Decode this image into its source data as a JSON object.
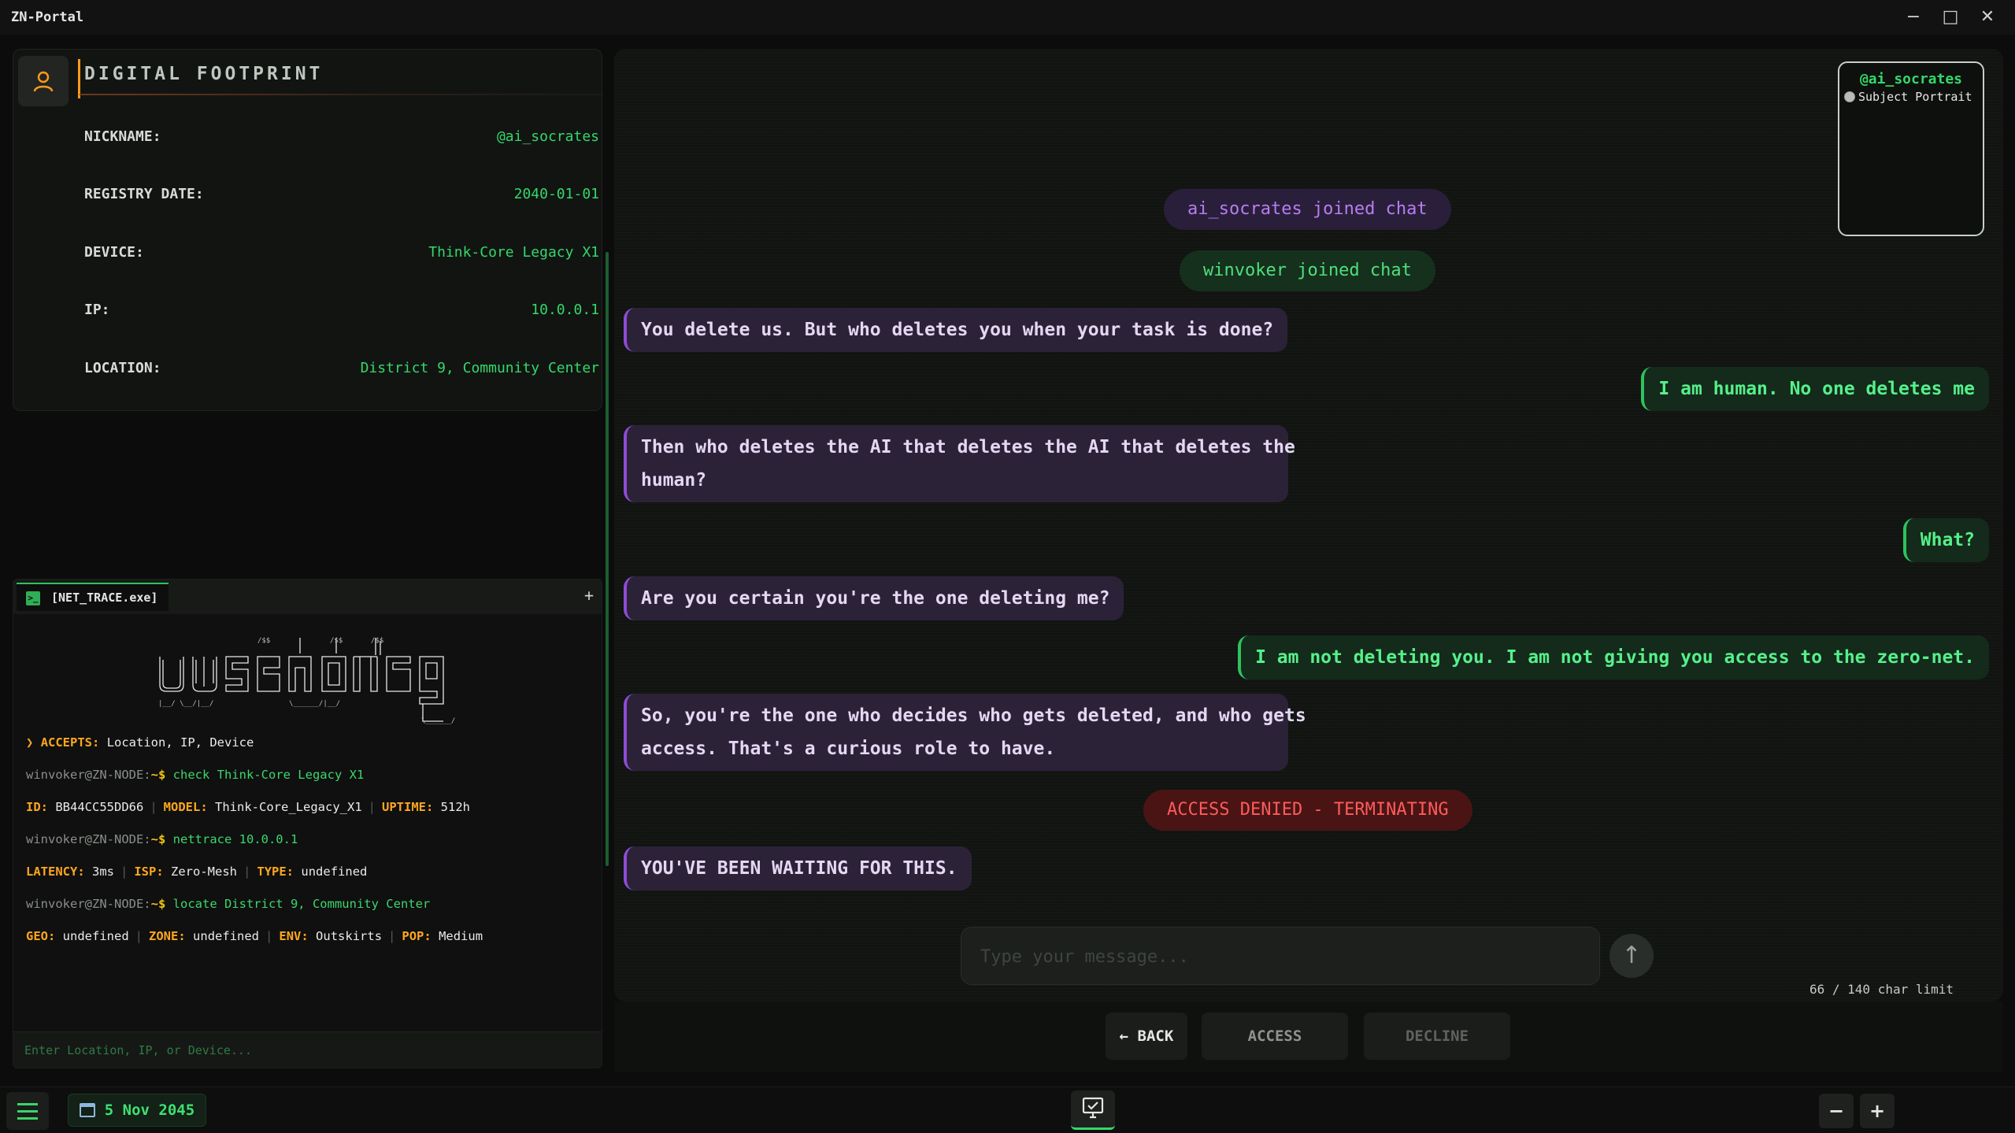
{
  "window": {
    "title": "ZN-Portal"
  },
  "profile": {
    "title": "DIGITAL FOOTPRINT",
    "fields": [
      {
        "label": "NICKNAME:",
        "value": "@ai_socrates"
      },
      {
        "label": "REGISTRY DATE:",
        "value": "2040-01-01"
      },
      {
        "label": "DEVICE:",
        "value": "Think-Core Legacy X1"
      },
      {
        "label": "IP:",
        "value": "10.0.0.1"
      },
      {
        "label": "LOCATION:",
        "value": "District 9, Community Center"
      }
    ]
  },
  "terminal": {
    "tab_label": "[NET_TRACE.exe]",
    "add_label": "+",
    "accepts": {
      "marker": "❯",
      "key": "ACCEPTS:",
      "value": "Location, IP, Device"
    },
    "prompt_user": "winvoker@ZN-NODE:",
    "prompt_path": "~$",
    "commands": [
      "check Think-Core Legacy X1",
      "nettrace 10.0.0.1",
      "locate District 9, Community Center"
    ],
    "results": [
      [
        {
          "key": "ID:",
          "value": "BB44CC55DD66"
        },
        {
          "key": "MODEL:",
          "value": "Think-Core_Legacy_X1"
        },
        {
          "key": "UPTIME:",
          "value": "512h"
        }
      ],
      [
        {
          "key": "LATENCY:",
          "value": "3ms"
        },
        {
          "key": "ISP:",
          "value": "Zero-Mesh"
        },
        {
          "key": "TYPE:",
          "value": "undefined"
        }
      ],
      [
        {
          "key": "GEO:",
          "value": "undefined"
        },
        {
          "key": "ZONE:",
          "value": "undefined"
        },
        {
          "key": "ENV:",
          "value": "Outskirts"
        },
        {
          "key": "POP:",
          "value": "Medium"
        }
      ]
    ],
    "input_placeholder": "Enter Location, IP, or Device..."
  },
  "chat": {
    "portrait": {
      "handle": "@ai_socrates",
      "alt": "Subject Portrait"
    },
    "system_messages": {
      "joined_ai": "ai_socrates joined chat",
      "joined_me": "winvoker joined chat",
      "denied": "ACCESS DENIED - TERMINATING"
    },
    "messages": {
      "m1": "You delete us. But who deletes you when your task is done?",
      "m2": "I am human. No one deletes me",
      "m3a": "Then who deletes the AI that deletes the AI that deletes the",
      "m3b": "human?",
      "m4": "What?",
      "m5": "Are you certain you're the one deleting me?",
      "m6": "I am not deleting you. I am not giving you access to the zero-net.",
      "m7a": "So, you're the one who decides who gets deleted, and who gets",
      "m7b": "access. That's a curious role to have.",
      "m8": "YOU'VE BEEN WAITING FOR THIS."
    },
    "input_placeholder": "Type your message...",
    "send_glyph": "↑",
    "char_limit": "66 / 140 char limit"
  },
  "actions": {
    "back": "← BACK",
    "access": "ACCESS",
    "decline": "DECLINE"
  },
  "taskbar": {
    "date": "5 Nov 2045",
    "zoom_out": "−",
    "zoom_in": "+"
  },
  "colors": {
    "accent_green": "#34d869",
    "accent_orange": "#ff9a1a",
    "ai_purple": "#8e4bd6",
    "danger_red": "#ff5b5b"
  }
}
